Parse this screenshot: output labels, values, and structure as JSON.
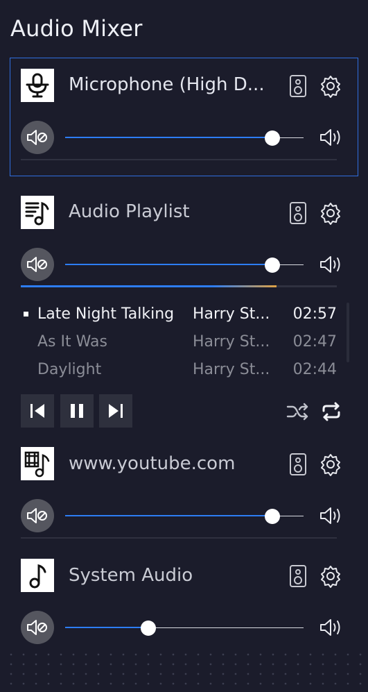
{
  "header": {
    "title": "Audio Mixer"
  },
  "colors": {
    "background": "#1b1c2b",
    "accent": "#2d7df4",
    "selected_border": "#2f6fe0",
    "progress_end": "#e0a243"
  },
  "sources": [
    {
      "name": "Microphone  (High  D...",
      "icon": "microphone-icon",
      "volume": 0.87,
      "selected": true
    },
    {
      "name": "Audio Playlist",
      "icon": "playlist-music-icon",
      "volume": 0.87,
      "playback_progress": 0.81
    },
    {
      "name": "www.youtube.com",
      "icon": "video-music-icon",
      "volume": 0.87
    },
    {
      "name": "System Audio",
      "icon": "music-note-icon",
      "volume": 0.35
    }
  ],
  "playlist": {
    "tracks": [
      {
        "title": "Late Night Talking",
        "artist": "Harry  St...",
        "duration": "02:57",
        "playing": true
      },
      {
        "title": "As It Was",
        "artist": "Harry  St...",
        "duration": "02:47"
      },
      {
        "title": "Daylight",
        "artist": "Harry  St...",
        "duration": "02:44"
      }
    ],
    "controls": [
      "previous-icon",
      "pause-icon",
      "next-icon",
      "shuffle-icon",
      "repeat-icon"
    ]
  }
}
